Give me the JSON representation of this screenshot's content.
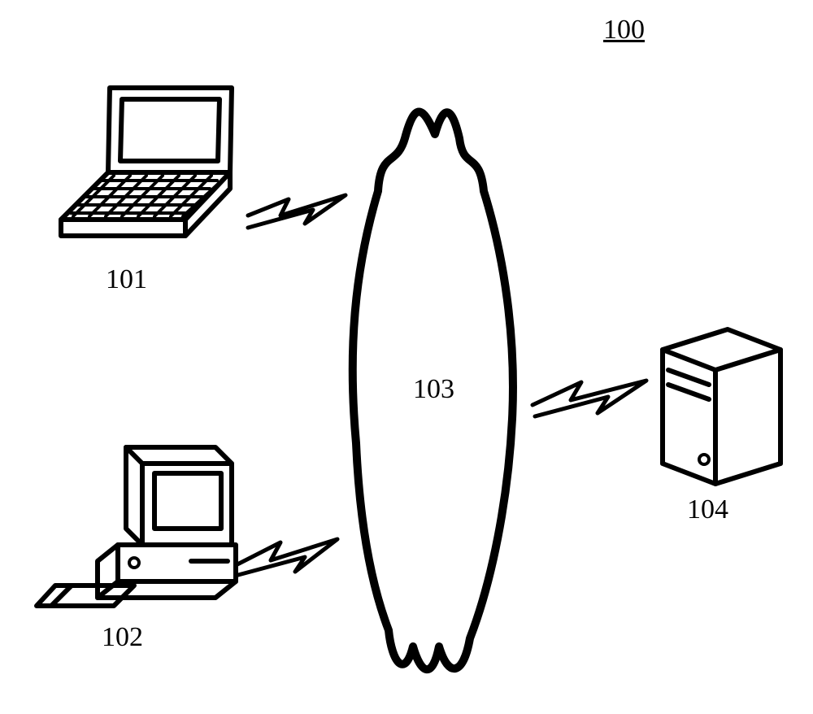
{
  "figure": {
    "number": "100"
  },
  "nodes": {
    "laptop": {
      "label": "101"
    },
    "desktop": {
      "label": "102"
    },
    "network": {
      "label": "103"
    },
    "server": {
      "label": "104"
    }
  }
}
